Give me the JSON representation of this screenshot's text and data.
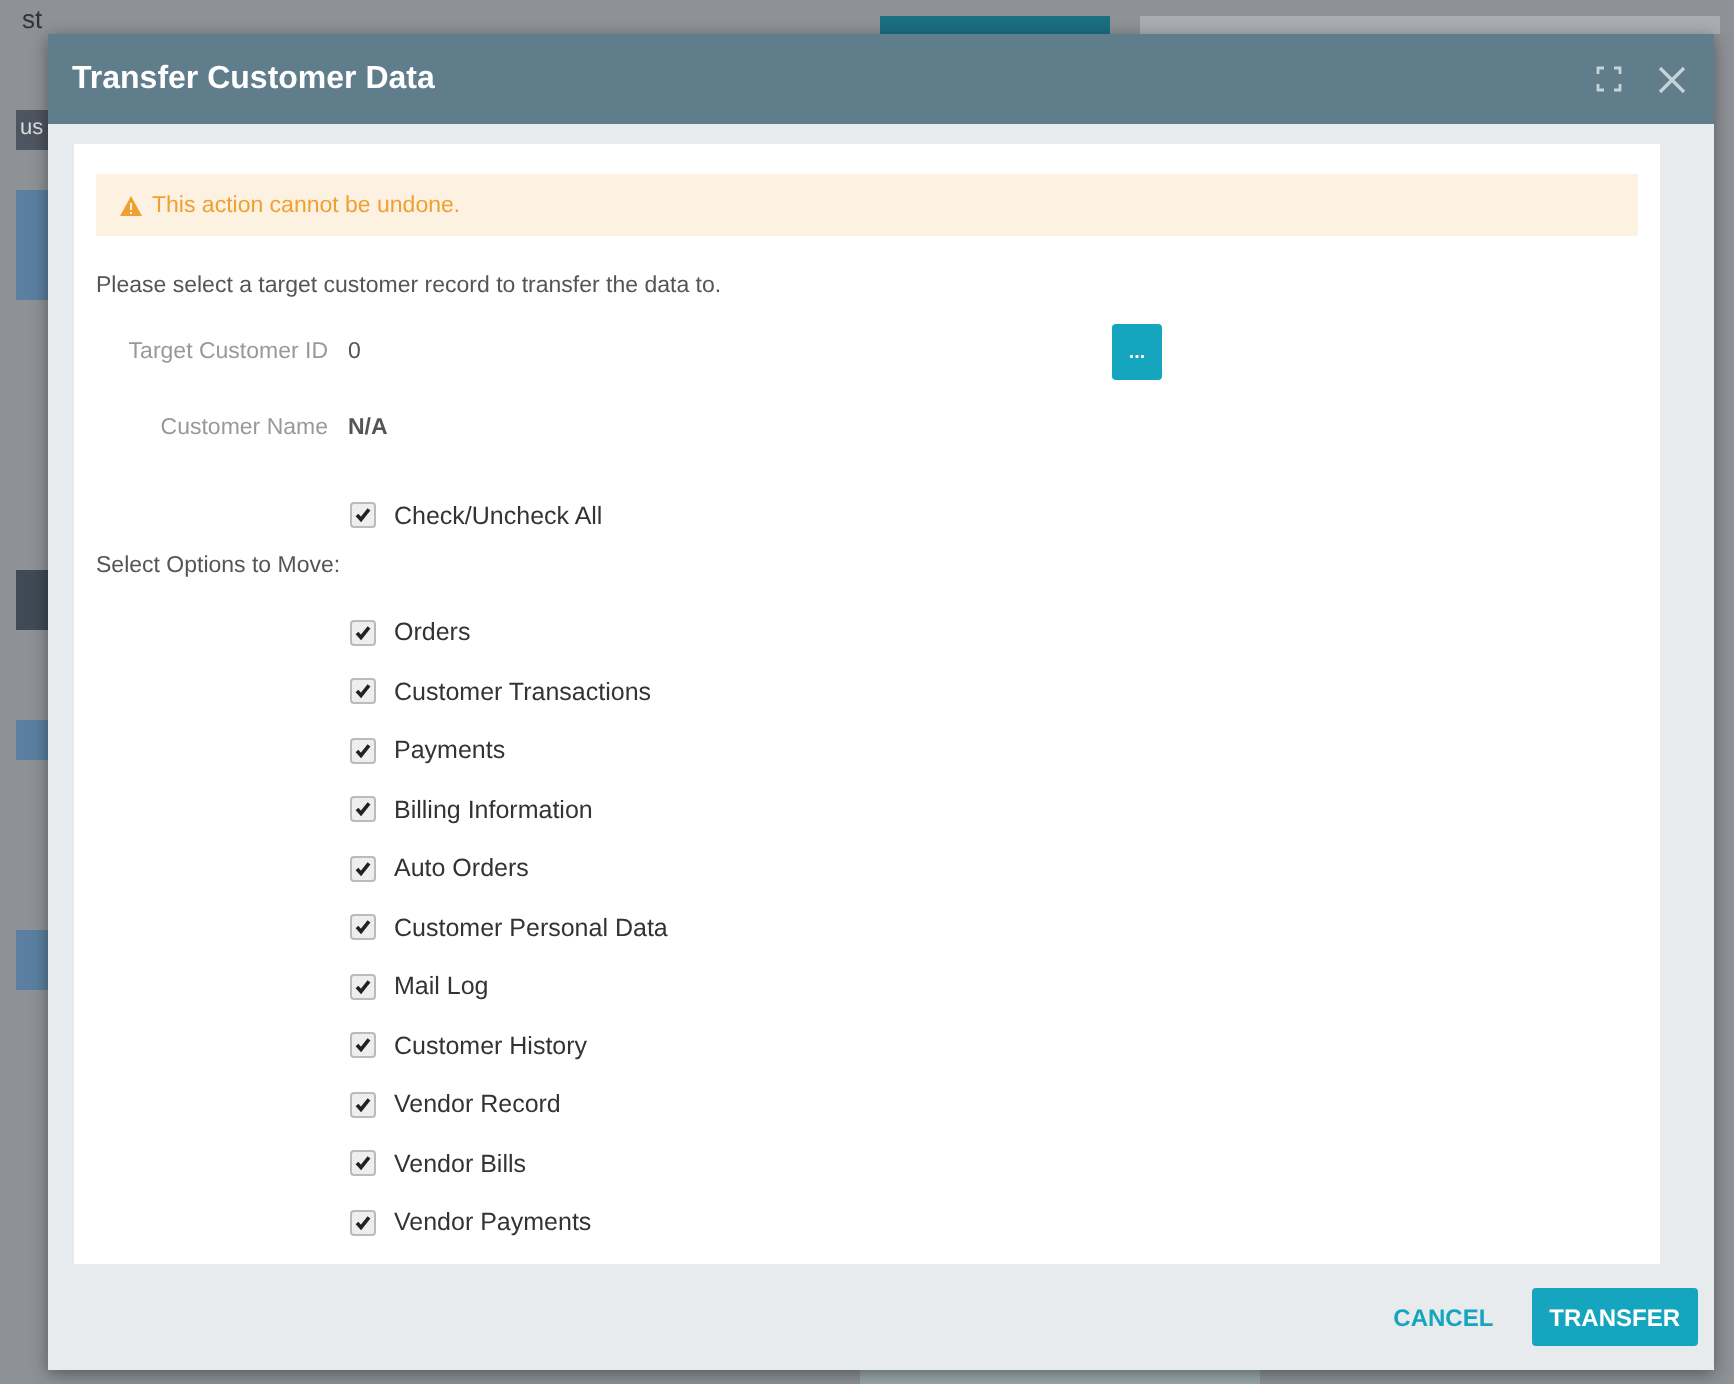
{
  "background_texts": [
    "st",
    "us"
  ],
  "dialog": {
    "title": "Transfer Customer Data",
    "warning": "This action cannot be undone.",
    "intro": "Please select a target customer record to transfer the data to.",
    "fields": [
      {
        "label": "Target Customer ID",
        "value": "0"
      },
      {
        "label": "Customer Name",
        "value": "N/A"
      }
    ],
    "lookup_button": "...",
    "check_all": {
      "label": "Check/Uncheck All",
      "checked": true
    },
    "options_heading": "Select Options to Move:",
    "options": [
      {
        "label": "Orders",
        "checked": true
      },
      {
        "label": "Customer Transactions",
        "checked": true
      },
      {
        "label": "Payments",
        "checked": true
      },
      {
        "label": "Billing Information",
        "checked": true
      },
      {
        "label": "Auto Orders",
        "checked": true
      },
      {
        "label": "Customer Personal Data",
        "checked": true
      },
      {
        "label": "Mail Log",
        "checked": true
      },
      {
        "label": "Customer History",
        "checked": true
      },
      {
        "label": "Vendor Record",
        "checked": true
      },
      {
        "label": "Vendor Bills",
        "checked": true
      },
      {
        "label": "Vendor Payments",
        "checked": true
      }
    ],
    "buttons": [
      {
        "label": "CANCEL",
        "kind": "flat"
      },
      {
        "label": "TRANSFER",
        "kind": "primary"
      }
    ]
  }
}
